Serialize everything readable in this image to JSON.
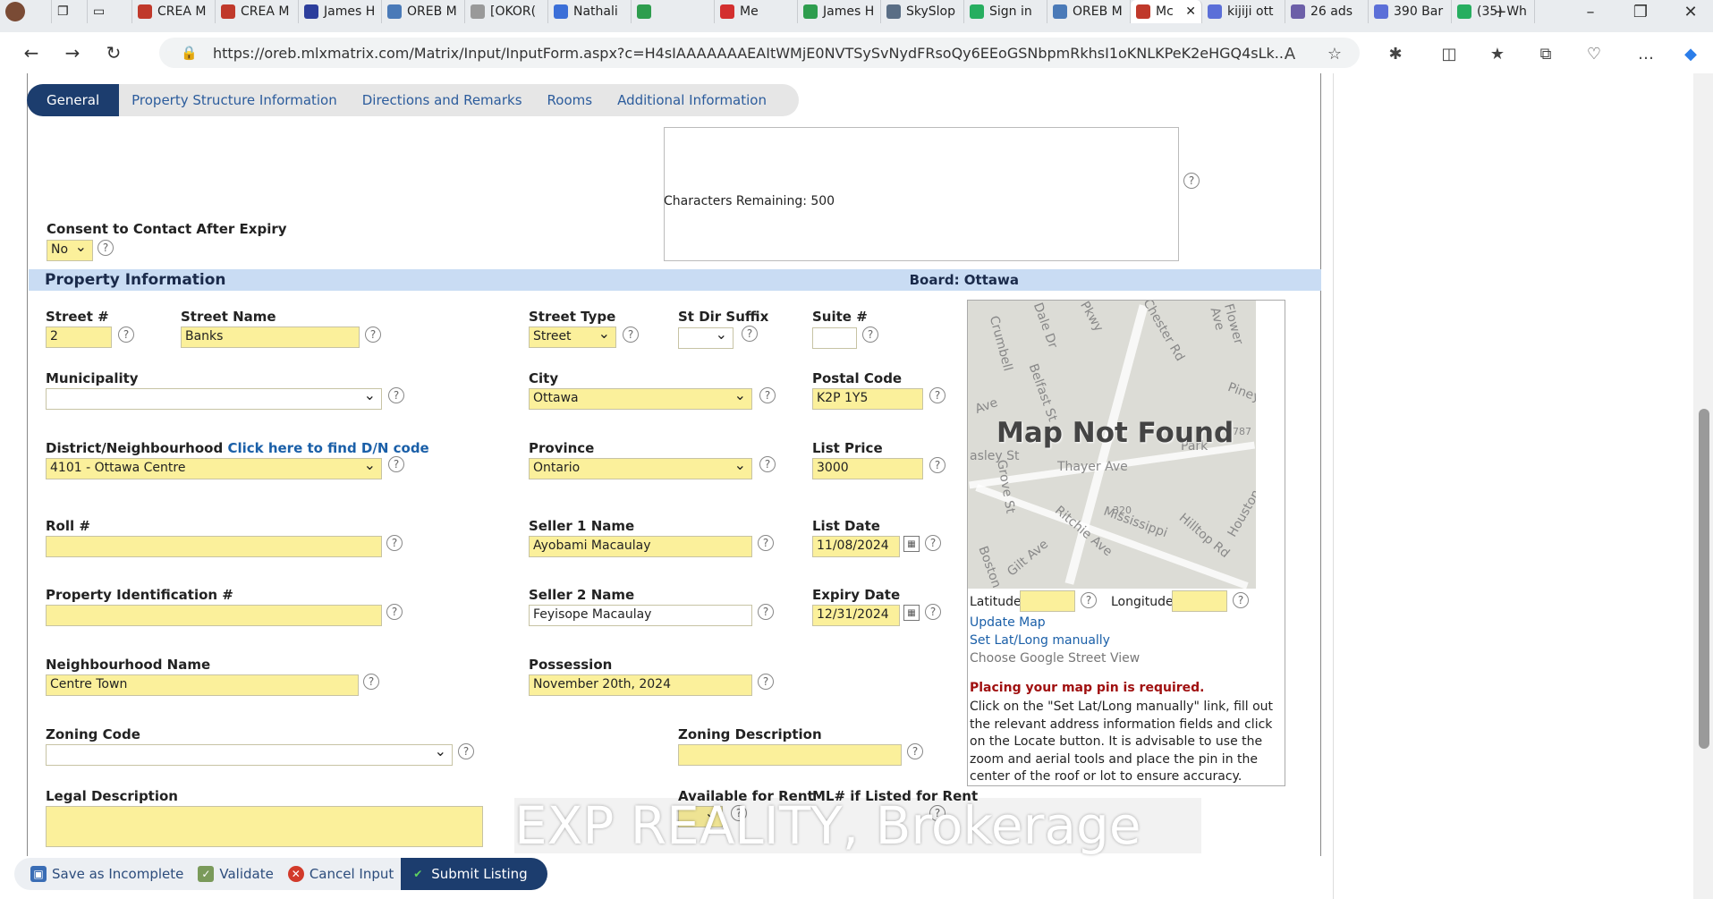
{
  "browser": {
    "tabs": [
      {
        "label": "CREA M",
        "color": "#c0392b"
      },
      {
        "label": "CREA M",
        "color": "#c0392b"
      },
      {
        "label": "James H",
        "color": "#2c3e9c"
      },
      {
        "label": "OREB M",
        "color": "#4a7ab8"
      },
      {
        "label": "[OKOR(",
        "color": "#999"
      },
      {
        "label": "Nathali",
        "color": "#3b6fd8"
      },
      {
        "label": "",
        "color": "#2e9d4e"
      },
      {
        "label": "Me",
        "color": "#d32f2f"
      },
      {
        "label": "James H",
        "color": "#2e9d4e"
      },
      {
        "label": "SkySlop",
        "color": "#5a6e85"
      },
      {
        "label": "Sign in",
        "color": "#27ae60"
      },
      {
        "label": "OREB M",
        "color": "#4a7ab8"
      },
      {
        "label": "Mc",
        "color": "#c0392b"
      },
      {
        "label": "kijiji ott",
        "color": "#5b6fd8"
      },
      {
        "label": "26 ads",
        "color": "#6c5fa8"
      },
      {
        "label": "390 Bar",
        "color": "#5b6fd8"
      },
      {
        "label": "(35) Wh",
        "color": "#27ae60"
      }
    ],
    "url": "https://oreb.mlxmatrix.com/Matrix/Input/InputForm.aspx?c=H4sIAAAAAAAEAItWMjE0NVTSySvNydFRsoQy6EEoGSNbpmRkhsI1oKNLKPeK2eHGQ4sLk..."
  },
  "steps": [
    "General",
    "Property Structure Information",
    "Directions and Remarks",
    "Rooms",
    "Additional Information"
  ],
  "remarks": {
    "chars_remaining": "Characters Remaining: 500"
  },
  "consent": {
    "label": "Consent to Contact After Expiry",
    "value": "No"
  },
  "section": {
    "title": "Property Information",
    "board": "Board: Ottawa"
  },
  "fields": {
    "street_num": {
      "label": "Street #",
      "value": "2"
    },
    "street_name": {
      "label": "Street Name",
      "value": "Banks"
    },
    "street_type": {
      "label": "Street Type",
      "value": "Street"
    },
    "st_dir": {
      "label": "St Dir Suffix",
      "value": ""
    },
    "suite": {
      "label": "Suite #",
      "value": ""
    },
    "municipality": {
      "label": "Municipality",
      "value": ""
    },
    "city": {
      "label": "City",
      "value": "Ottawa"
    },
    "postal": {
      "label": "Postal Code",
      "value": "K2P 1Y5"
    },
    "district": {
      "label": "District/Neighbourhood",
      "link": "Click here to find D/N code",
      "value": "4101 - Ottawa Centre"
    },
    "province": {
      "label": "Province",
      "value": "Ontario"
    },
    "list_price": {
      "label": "List Price",
      "value": "3000"
    },
    "roll": {
      "label": "Roll #",
      "value": ""
    },
    "seller1": {
      "label": "Seller 1 Name",
      "value": "Ayobami Macaulay"
    },
    "list_date": {
      "label": "List Date",
      "value": "11/08/2024"
    },
    "pin": {
      "label": "Property Identification #",
      "value": ""
    },
    "seller2": {
      "label": "Seller 2 Name",
      "value": "Feyisope Macaulay"
    },
    "expiry": {
      "label": "Expiry Date",
      "value": "12/31/2024"
    },
    "nbhd": {
      "label": "Neighbourhood Name",
      "value": "Centre Town"
    },
    "possession": {
      "label": "Possession",
      "value": "November 20th, 2024"
    },
    "zoning_code": {
      "label": "Zoning Code",
      "value": ""
    },
    "zoning_desc": {
      "label": "Zoning Description",
      "value": ""
    },
    "legal": {
      "label": "Legal Description",
      "value": ""
    },
    "avail_rent": {
      "label": "Available for Rent"
    },
    "ml_rent": {
      "label": "ML# if Listed for Rent"
    }
  },
  "map": {
    "not_found": "Map Not Found",
    "latitude": "Latitude",
    "longitude": "Longitude",
    "update": "Update Map",
    "set_manual": "Set Lat/Long manually",
    "street_view": "Choose Google Street View",
    "required": "Placing your map pin is required.",
    "instructions": "Click on the \"Set Lat/Long manually\" link, fill out the relevant address information fields and click on the Locate button. It is advisable to use the zoom and aerial tools and place the pin in the center of the roof or lot to ensure accuracy.",
    "streets": [
      "Dale Dr",
      "Chester Rd",
      "Flower Ave",
      "Piney",
      "Belfast St",
      "Ave",
      "asley St",
      "Thayer Ave",
      "Park",
      "787",
      "Grove St",
      "Mississippi",
      "Hilltop Rd",
      "Houston",
      "Ritchie Ave",
      "Boston",
      "Gilt Ave",
      "320",
      "Pkwy",
      "Crumbell"
    ]
  },
  "watermark": "EXP REALITY, Brokerage",
  "actions": {
    "save": "Save as Incomplete",
    "validate": "Validate",
    "cancel": "Cancel Input",
    "submit": "Submit Listing"
  }
}
